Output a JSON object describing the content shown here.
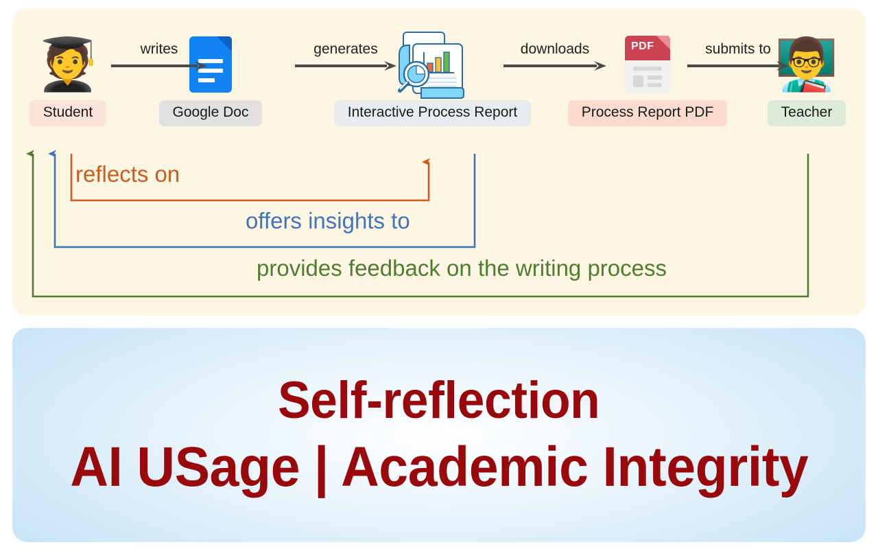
{
  "diagram": {
    "panel_bg": "#fdf6e2",
    "nodes": [
      {
        "id": "student",
        "label": "Student",
        "icon": "student-graduate-emoji",
        "glyph": "🧑‍🎓",
        "label_color": "#fae3d9"
      },
      {
        "id": "googledoc",
        "label": "Google Doc",
        "icon": "google-doc-icon",
        "glyph": "",
        "label_color": "#e3e1df"
      },
      {
        "id": "report",
        "label": "Interactive Process Report",
        "icon": "interactive-report-icon",
        "glyph": "",
        "label_color": "#e9ecee"
      },
      {
        "id": "pdf",
        "label": "Process Report PDF",
        "icon": "pdf-file-icon",
        "glyph": "",
        "label_color": "#fadbcd"
      },
      {
        "id": "teacher",
        "label": "Teacher",
        "icon": "teacher-emoji",
        "glyph": "👨‍🏫",
        "label_color": "#dcecd8"
      }
    ],
    "forward_arrows": [
      {
        "id": "writes",
        "label": "writes",
        "from": "student",
        "to": "googledoc",
        "color": "#4a4a4a"
      },
      {
        "id": "generates",
        "label": "generates",
        "from": "googledoc",
        "to": "report",
        "color": "#4a4a4a"
      },
      {
        "id": "downloads",
        "label": "downloads",
        "from": "report",
        "to": "pdf",
        "color": "#4a4a4a"
      },
      {
        "id": "submits",
        "label": "submits to",
        "from": "pdf",
        "to": "teacher",
        "color": "#4a4a4a"
      }
    ],
    "feedback_arrows": [
      {
        "id": "reflects-on",
        "label": "reflects on",
        "from": "student",
        "to": "report",
        "color": "#cc5c1c"
      },
      {
        "id": "offers-insights",
        "label": "offers insights to",
        "from": "report",
        "to": "student",
        "color": "#4273bd"
      },
      {
        "id": "provides-feedback",
        "label": "provides feedback on the writing process",
        "from": "teacher",
        "to": "student",
        "color": "#4e7d31"
      }
    ],
    "pdf_icon_text": "PDF"
  },
  "banner": {
    "line1": "Self-reflection",
    "line2": "AI  USage | Academic Integrity",
    "text_color": "#99080b"
  }
}
